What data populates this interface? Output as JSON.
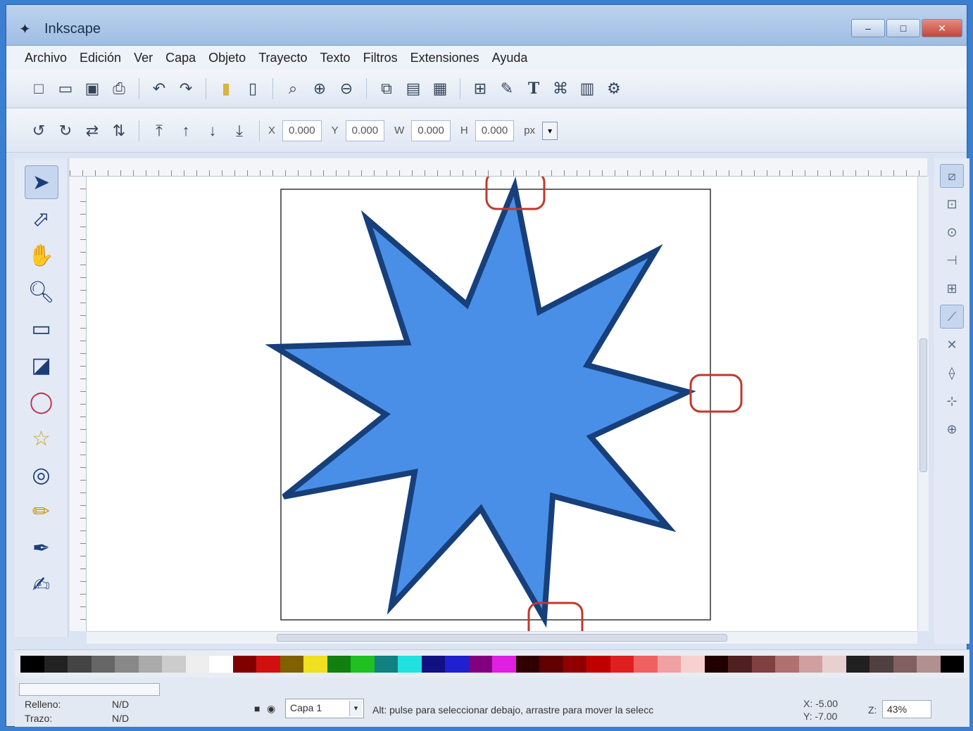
{
  "window": {
    "title": "Inkscape",
    "app_icon": "inkscape-logo-icon",
    "buttons": [
      "–",
      "□",
      "✕"
    ]
  },
  "menu": [
    "Archivo",
    "Edición",
    "Ver",
    "Capa",
    "Objeto",
    "Trayecto",
    "Texto",
    "Filtros",
    "Extensiones",
    "Ayuda"
  ],
  "command_bar": {
    "icons": [
      "new-icon",
      "open-icon",
      "save-icon",
      "print-icon",
      "undo-icon",
      "redo-icon",
      "copy-icon",
      "paste-icon",
      "zoom-selection-icon",
      "zoom-drawing-icon",
      "zoom-page-icon",
      "duplicate-icon",
      "clone-icon",
      "group-icon",
      "ungroup-icon",
      "fill-stroke-icon",
      "text-font-icon",
      "xml-editor-icon",
      "align-icon",
      "preferences-icon"
    ]
  },
  "controls_bar": {
    "icons": [
      "rotate-ccw-icon",
      "rotate-cw-icon",
      "flip-h-icon",
      "flip-v-icon",
      "raise-top-icon",
      "raise-icon",
      "lower-icon",
      "lower-bottom-icon"
    ],
    "fields": [
      {
        "label": "X",
        "value": "0.000"
      },
      {
        "label": "Y",
        "value": "0.000"
      },
      {
        "label": "W",
        "value": "0.000"
      },
      {
        "label": "H",
        "value": "0.000"
      }
    ],
    "unit": "px"
  },
  "toolbox": [
    "selector-tool-icon",
    "node-tool-icon",
    "tweak-tool-icon",
    "zoom-tool-icon",
    "rectangle-tool-icon",
    "3d-box-tool-icon",
    "ellipse-tool-icon",
    "star-tool-icon",
    "spiral-tool-icon",
    "pencil-tool-icon",
    "pen-tool-icon",
    "calligraphy-tool-icon"
  ],
  "snap_bar": [
    "snap-toggle-icon",
    "snap-bbox-icon",
    "snap-nodes-icon",
    "snap-guide-icon",
    "snap-grid-icon"
  ],
  "canvas": {
    "star_fill": "#4a8fe7",
    "star_stroke": "#173f7a",
    "highlight_color": "#c0392b"
  },
  "palette": [
    "#000000",
    "#222222",
    "#444444",
    "#666666",
    "#888888",
    "#aaaaaa",
    "#cccccc",
    "#eeeeee",
    "#ffffff",
    "#800000",
    "#d01010",
    "#806000",
    "#f0e020",
    "#108010",
    "#20c020",
    "#108080",
    "#20e0e0",
    "#101080",
    "#2020d0",
    "#800080",
    "#e020e0",
    "#300000",
    "#600000",
    "#900000",
    "#c00000",
    "#e02020",
    "#f06060",
    "#f0a0a0",
    "#f8d0d0",
    "#200000",
    "#502020",
    "#804040",
    "#b07070",
    "#d0a0a0",
    "#e8d0d0",
    "#202020",
    "#504040",
    "#806060",
    "#b09090",
    "#000000"
  ],
  "status": {
    "fill_label": "Relleno:",
    "stroke_label": "Trazo:",
    "fill_value": "N/D",
    "stroke_value": "N/D",
    "layer": "Capa 1",
    "message": "Alt: pulse para seleccionar debajo, arrastre para mover la selecc",
    "x_label": "X:",
    "y_label": "Y:",
    "x_value": "-5.00",
    "y_value": "-7.00",
    "zoom_label": "Z:",
    "zoom_value": "43%"
  }
}
